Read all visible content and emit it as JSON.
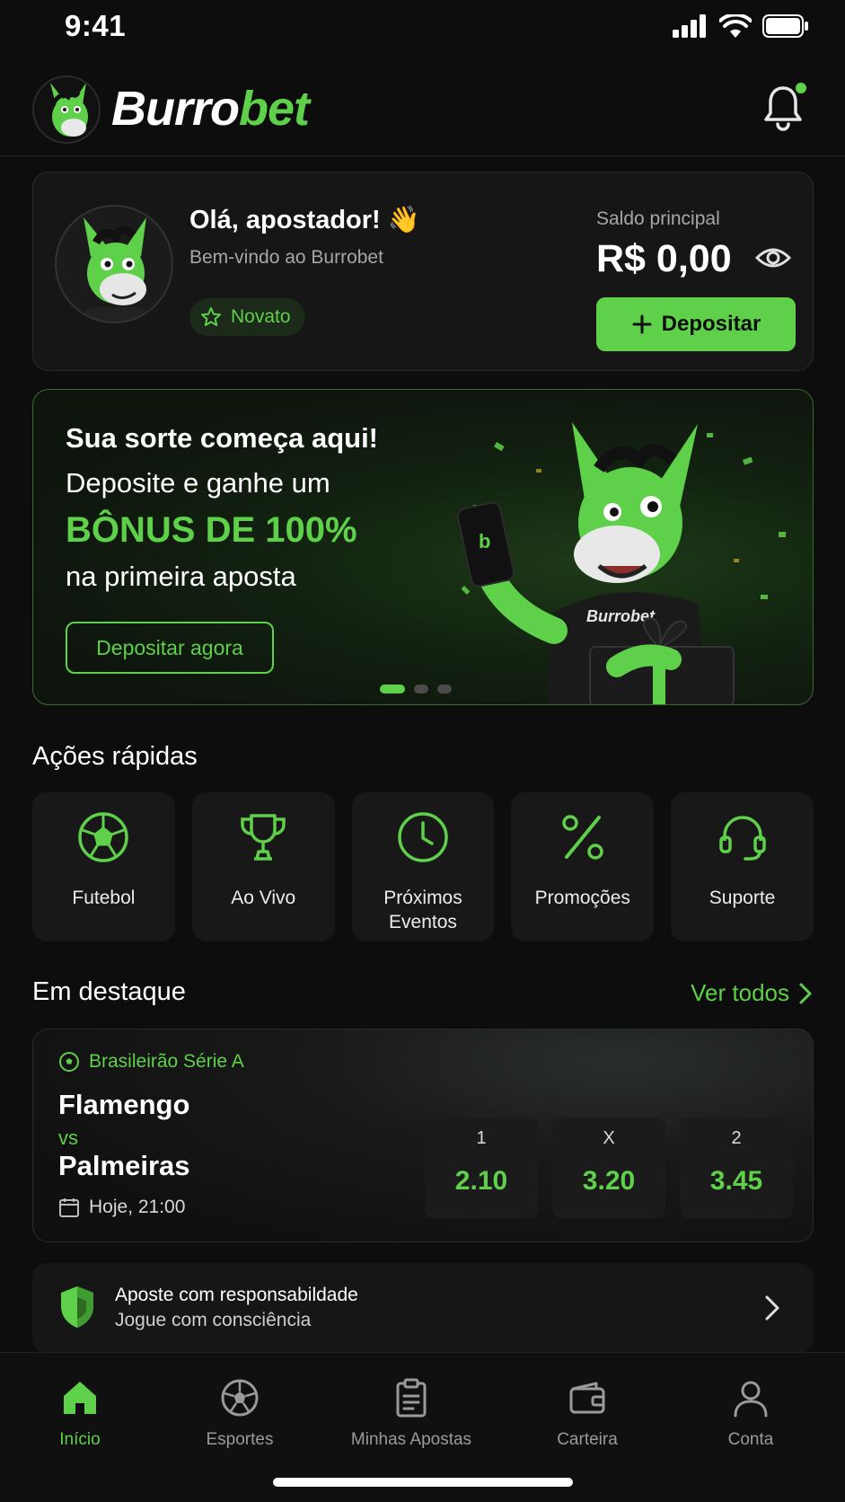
{
  "status_bar": {
    "time": "9:41"
  },
  "header": {
    "logo_primary": "Burro",
    "logo_accent": "bet",
    "notification_dot": true
  },
  "profile": {
    "greeting": "Olá, apostador! 👋",
    "welcome": "Bem-vindo ao Burrobet",
    "rank": "Novato",
    "balance_label": "Saldo principal",
    "balance_value": "R$ 0,00",
    "deposit_label": "Depositar"
  },
  "promo": {
    "title": "Sua sorte começa aqui!",
    "line1": "Deposite e ganhe um",
    "bonus": "BÔNUS DE 100%",
    "line2": "na primeira aposta",
    "cta": "Depositar agora",
    "shirt_text": "Burrobet",
    "slides": 3,
    "active_slide": 1
  },
  "quick_actions": {
    "title": "Ações rápidas",
    "items": [
      {
        "label": "Futebol",
        "icon": "soccer-ball-icon"
      },
      {
        "label": "Ao Vivo",
        "icon": "trophy-icon"
      },
      {
        "label": "Próximos Eventos",
        "icon": "clock-icon"
      },
      {
        "label": "Promoções",
        "icon": "percent-icon"
      },
      {
        "label": "Suporte",
        "icon": "headset-icon"
      }
    ]
  },
  "featured": {
    "title": "Em destaque",
    "see_all": "Ver todos",
    "match": {
      "league": "Brasileirão Série A",
      "home": "Flamengo",
      "vs": "vs",
      "away": "Palmeiras",
      "time": "Hoje, 21:00",
      "odds": [
        {
          "label": "1",
          "value": "2.10"
        },
        {
          "label": "X",
          "value": "3.20"
        },
        {
          "label": "2",
          "value": "3.45"
        }
      ]
    }
  },
  "responsible": {
    "title": "Aposte com responsabildade",
    "subtitle": "Jogue com consciência"
  },
  "tabbar": {
    "items": [
      {
        "label": "Início",
        "icon": "home-icon",
        "active": true
      },
      {
        "label": "Esportes",
        "icon": "soccer-ball-icon",
        "active": false
      },
      {
        "label": "Minhas Apostas",
        "icon": "clipboard-icon",
        "active": false
      },
      {
        "label": "Carteira",
        "icon": "wallet-icon",
        "active": false
      },
      {
        "label": "Conta",
        "icon": "user-icon",
        "active": false
      }
    ]
  },
  "colors": {
    "accent": "#5fd04a",
    "background": "#0d0d0d",
    "card": "#161616"
  }
}
